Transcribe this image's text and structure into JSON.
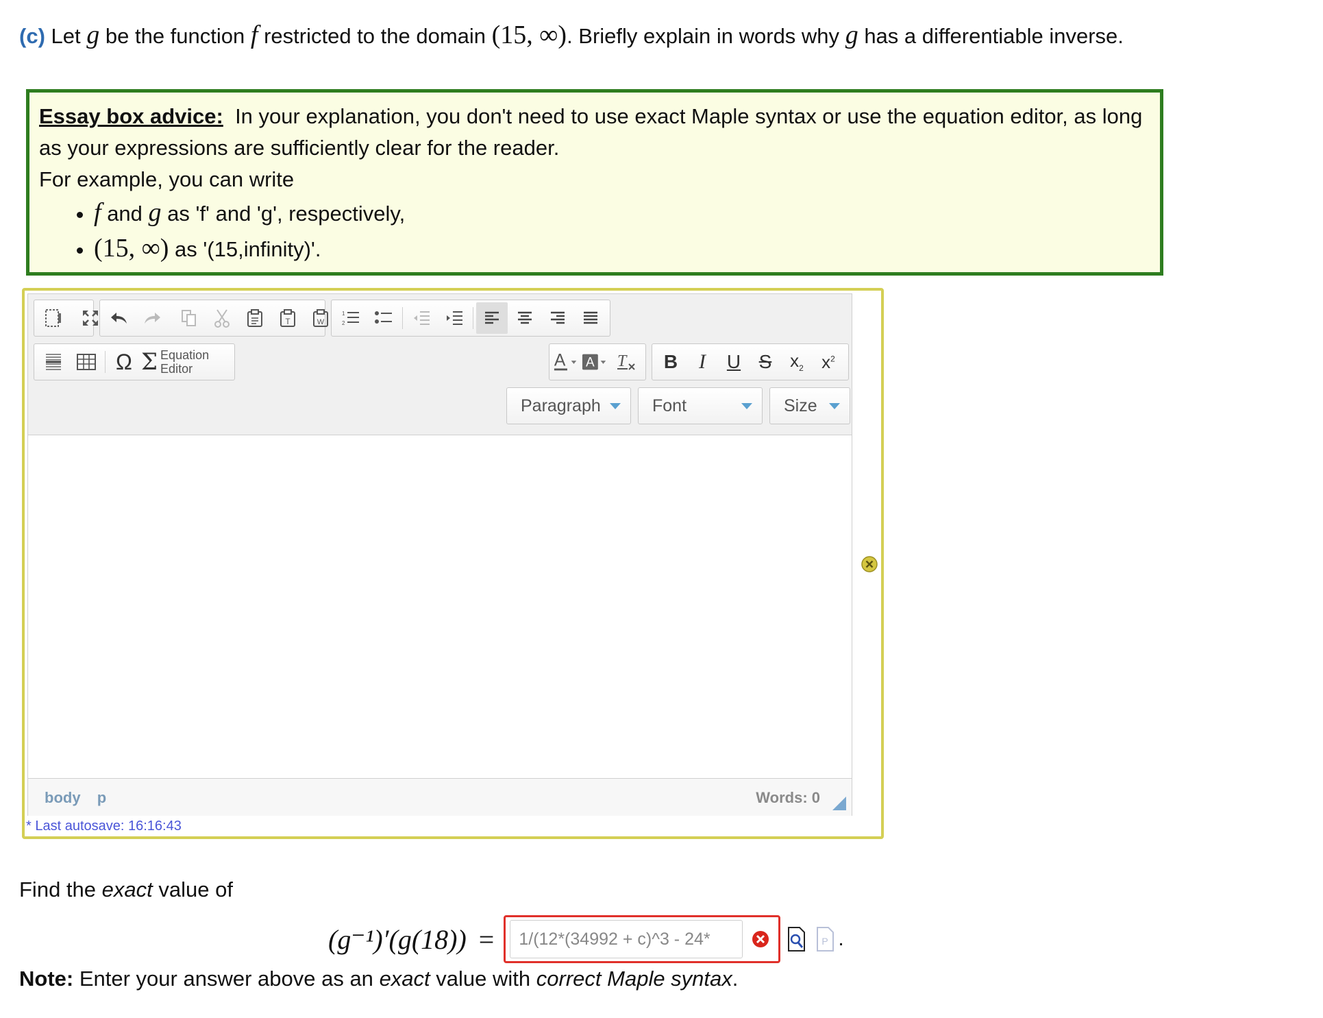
{
  "question": {
    "label": "(c)",
    "text_1": "Let",
    "var_g": "g",
    "text_2": "be the function",
    "var_f": "f",
    "text_3": "restricted to the domain",
    "domain": "(15, ∞)",
    "text_4": ". Briefly explain in words why",
    "text_5": "has a differentiable inverse."
  },
  "advice": {
    "heading": "Essay box advice",
    "colon": ":",
    "body": "In your explanation, you don't need to use exact Maple syntax or use the equation editor, as long as your expressions are sufficiently clear for the reader.",
    "example_intro": "For example, you can write",
    "bullet1_f": "f",
    "bullet1_and": "and",
    "bullet1_g": "g",
    "bullet1_rest": "as 'f' and 'g', respectively,",
    "bullet2_math": "(15, ∞)",
    "bullet2_rest": "as '(15,infinity)'."
  },
  "editor": {
    "equation_editor_line1": "Equation",
    "equation_editor_line2": "Editor",
    "paragraph_select": "Paragraph",
    "font_select": "Font",
    "size_select": "Size",
    "path_body": "body",
    "path_p": "p",
    "words": "Words: 0",
    "autosave": "* Last autosave: 16:16:43"
  },
  "find": {
    "text_1": "Find the",
    "exact": "exact",
    "text_2": "value of",
    "lhs": "(g⁻¹)′(g(18))",
    "equals": "=",
    "answer_value": "1/(12*(34992 + c)^3 - 24*"
  },
  "note": {
    "bold": "Note:",
    "text_1": "Enter your answer above as an",
    "exact": "exact",
    "text_2": "value with",
    "syntax": "correct Maple syntax",
    "period": "."
  },
  "colors": {
    "label_blue": "#2e6bb0",
    "advice_border": "#2e7d1f",
    "advice_bg": "#fbfde3",
    "editor_border": "#d4cf55",
    "error_red": "#e0302a",
    "autosave_blue": "#4a55d8"
  }
}
